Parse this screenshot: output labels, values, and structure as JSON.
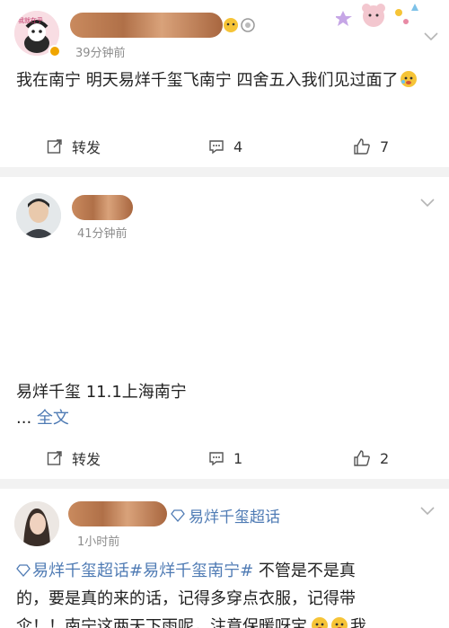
{
  "posts": [
    {
      "avatar_text": "我就在乎",
      "time": "39分钟前",
      "text": "我在南宁  明天易烊千玺飞南宁  四舍五入我们见过面了",
      "actions": {
        "repost": "转发",
        "comment": "4",
        "like": "7"
      }
    },
    {
      "time": "41分钟前",
      "text": "易烊千玺 11.1上海南宁",
      "more_prefix": "...",
      "more": "全文",
      "actions": {
        "repost": "转发",
        "comment": "1",
        "like": "2"
      }
    },
    {
      "topic": "易烊千玺超话",
      "time": "1小时前",
      "text_link1": "易烊千玺超话",
      "text_link2": "#易烊千玺南宁#",
      "text_line1_rest": " 不管是不是真",
      "text_line2": "的，要是真的来的话，记得多穿点衣服，记得带",
      "text_line3": "伞！！南宁这两天下雨呢，注意保暖呀宝",
      "text_tail": "我"
    }
  ],
  "colors": {
    "link": "#4f7bb4",
    "separator": "#f2f2f2",
    "time": "#8c8c8c"
  },
  "icons": [
    "repost-icon",
    "comment-icon",
    "like-icon",
    "chevron-down-icon",
    "diamond-icon",
    "emoji-icon",
    "sticker-decoration"
  ]
}
